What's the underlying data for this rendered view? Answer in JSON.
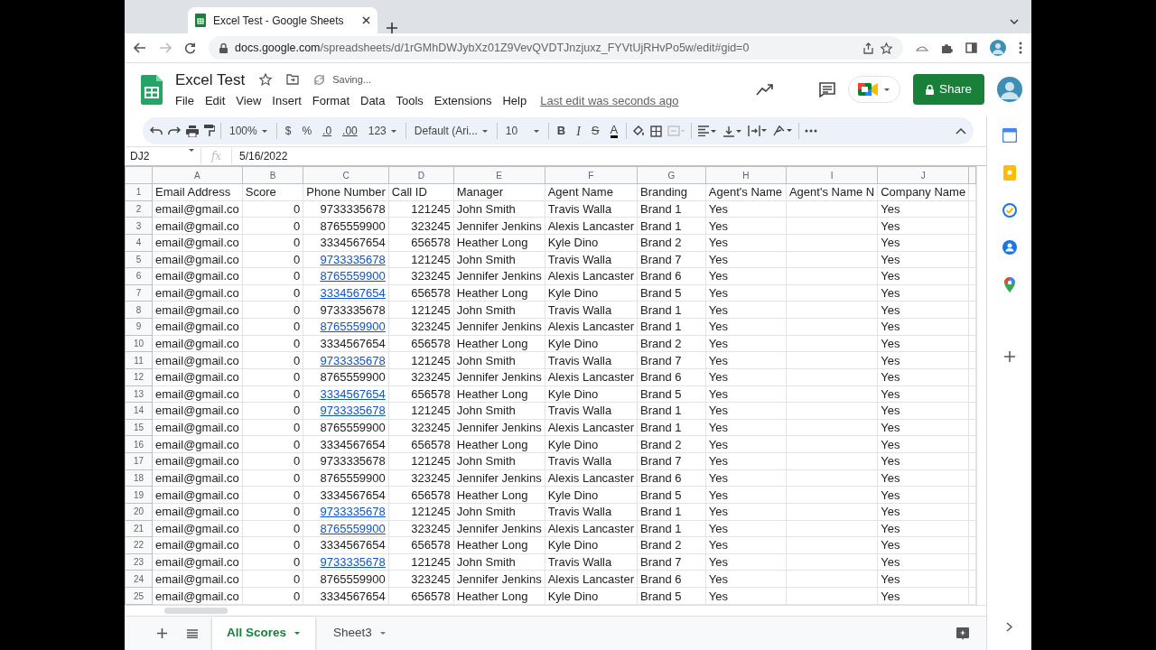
{
  "browser": {
    "tab_title": "Excel Test - Google Sheets",
    "url_host": "docs.google.com",
    "url_path": "/spreadsheets/d/1rGMhDWJybXz01Z9VevQVDTJnzjuxz_FYVtUjRHvPo5w/edit#gid=0"
  },
  "doc": {
    "title": "Excel Test",
    "save_status": "Saving...",
    "menus": [
      "File",
      "Edit",
      "View",
      "Insert",
      "Format",
      "Data",
      "Tools",
      "Extensions",
      "Help"
    ],
    "last_edit": "Last edit was seconds ago",
    "share": "Share"
  },
  "toolbar": {
    "zoom": "100%",
    "currency": "$",
    "percent": "%",
    "dec_less": ".0",
    "dec_more": ".00",
    "format": "123",
    "font": "Default (Ari...",
    "size": "10",
    "bold": "B",
    "italic": "I",
    "strike": "S",
    "text_color": "A"
  },
  "formula_bar": {
    "cell_ref": "DJ2",
    "fx": "fx",
    "value": "5/16/2022"
  },
  "header_row_num": "1",
  "columns": [
    {
      "letter": "A",
      "header": "Email Address",
      "kind": "text"
    },
    {
      "letter": "B",
      "header": "Score",
      "kind": "number"
    },
    {
      "letter": "C",
      "header": "Phone Number",
      "kind": "number"
    },
    {
      "letter": "D",
      "header": "Call ID",
      "kind": "number"
    },
    {
      "letter": "E",
      "header": "Manager",
      "kind": "text"
    },
    {
      "letter": "F",
      "header": "Agent Name",
      "kind": "text"
    },
    {
      "letter": "G",
      "header": "Branding",
      "kind": "text"
    },
    {
      "letter": "H",
      "header": "Agent's Name",
      "kind": "text"
    },
    {
      "letter": "I",
      "header": "Agent's Name N",
      "kind": "text"
    },
    {
      "letter": "J",
      "header": "Company Name",
      "kind": "text"
    }
  ],
  "rows": [
    {
      "num": "2",
      "A": "email@gmail.co",
      "B": "0",
      "C": "9733335678",
      "D": "121245",
      "E": "John Smith",
      "F": "Travis Walla",
      "G": "Brand 1",
      "H": "Yes",
      "J": "Yes",
      "phone_link": false
    },
    {
      "num": "3",
      "A": "email@gmail.co",
      "B": "0",
      "C": "8765559900",
      "D": "323245",
      "E": "Jennifer Jenkins",
      "F": "Alexis Lancaster",
      "G": "Brand 1",
      "H": "Yes",
      "J": "Yes",
      "phone_link": false
    },
    {
      "num": "4",
      "A": "email@gmail.co",
      "B": "0",
      "C": "3334567654",
      "D": "656578",
      "E": "Heather Long",
      "F": "Kyle Dino",
      "G": "Brand 2",
      "H": "Yes",
      "J": "Yes",
      "phone_link": false
    },
    {
      "num": "5",
      "A": "email@gmail.co",
      "B": "0",
      "C": "9733335678",
      "D": "121245",
      "E": "John Smith",
      "F": "Travis Walla",
      "G": "Brand 7",
      "H": "Yes",
      "J": "Yes",
      "phone_link": true
    },
    {
      "num": "6",
      "A": "email@gmail.co",
      "B": "0",
      "C": "8765559900",
      "D": "323245",
      "E": "Jennifer Jenkins",
      "F": "Alexis Lancaster",
      "G": "Brand 6",
      "H": "Yes",
      "J": "Yes",
      "phone_link": true
    },
    {
      "num": "7",
      "A": "email@gmail.co",
      "B": "0",
      "C": "3334567654",
      "D": "656578",
      "E": "Heather Long",
      "F": "Kyle Dino",
      "G": "Brand 5",
      "H": "Yes",
      "J": "Yes",
      "phone_link": true
    },
    {
      "num": "8",
      "A": "email@gmail.co",
      "B": "0",
      "C": "9733335678",
      "D": "121245",
      "E": "John Smith",
      "F": "Travis Walla",
      "G": "Brand 1",
      "H": "Yes",
      "J": "Yes",
      "phone_link": false
    },
    {
      "num": "9",
      "A": "email@gmail.co",
      "B": "0",
      "C": "8765559900",
      "D": "323245",
      "E": "Jennifer Jenkins",
      "F": "Alexis Lancaster",
      "G": "Brand 1",
      "H": "Yes",
      "J": "Yes",
      "phone_link": true
    },
    {
      "num": "10",
      "A": "email@gmail.co",
      "B": "0",
      "C": "3334567654",
      "D": "656578",
      "E": "Heather Long",
      "F": "Kyle Dino",
      "G": "Brand 2",
      "H": "Yes",
      "J": "Yes",
      "phone_link": false
    },
    {
      "num": "11",
      "A": "email@gmail.co",
      "B": "0",
      "C": "9733335678",
      "D": "121245",
      "E": "John Smith",
      "F": "Travis Walla",
      "G": "Brand 7",
      "H": "Yes",
      "J": "Yes",
      "phone_link": true
    },
    {
      "num": "12",
      "A": "email@gmail.co",
      "B": "0",
      "C": "8765559900",
      "D": "323245",
      "E": "Jennifer Jenkins",
      "F": "Alexis Lancaster",
      "G": "Brand 6",
      "H": "Yes",
      "J": "Yes",
      "phone_link": false
    },
    {
      "num": "13",
      "A": "email@gmail.co",
      "B": "0",
      "C": "3334567654",
      "D": "656578",
      "E": "Heather Long",
      "F": "Kyle Dino",
      "G": "Brand 5",
      "H": "Yes",
      "J": "Yes",
      "phone_link": true
    },
    {
      "num": "14",
      "A": "email@gmail.co",
      "B": "0",
      "C": "9733335678",
      "D": "121245",
      "E": "John Smith",
      "F": "Travis Walla",
      "G": "Brand 1",
      "H": "Yes",
      "J": "Yes",
      "phone_link": true
    },
    {
      "num": "15",
      "A": "email@gmail.co",
      "B": "0",
      "C": "8765559900",
      "D": "323245",
      "E": "Jennifer Jenkins",
      "F": "Alexis Lancaster",
      "G": "Brand 1",
      "H": "Yes",
      "J": "Yes",
      "phone_link": false
    },
    {
      "num": "16",
      "A": "email@gmail.co",
      "B": "0",
      "C": "3334567654",
      "D": "656578",
      "E": "Heather Long",
      "F": "Kyle Dino",
      "G": "Brand 2",
      "H": "Yes",
      "J": "Yes",
      "phone_link": false
    },
    {
      "num": "17",
      "A": "email@gmail.co",
      "B": "0",
      "C": "9733335678",
      "D": "121245",
      "E": "John Smith",
      "F": "Travis Walla",
      "G": "Brand 7",
      "H": "Yes",
      "J": "Yes",
      "phone_link": false
    },
    {
      "num": "18",
      "A": "email@gmail.co",
      "B": "0",
      "C": "8765559900",
      "D": "323245",
      "E": "Jennifer Jenkins",
      "F": "Alexis Lancaster",
      "G": "Brand 6",
      "H": "Yes",
      "J": "Yes",
      "phone_link": false
    },
    {
      "num": "19",
      "A": "email@gmail.co",
      "B": "0",
      "C": "3334567654",
      "D": "656578",
      "E": "Heather Long",
      "F": "Kyle Dino",
      "G": "Brand 5",
      "H": "Yes",
      "J": "Yes",
      "phone_link": false
    },
    {
      "num": "20",
      "A": "email@gmail.co",
      "B": "0",
      "C": "9733335678",
      "D": "121245",
      "E": "John Smith",
      "F": "Travis Walla",
      "G": "Brand 1",
      "H": "Yes",
      "J": "Yes",
      "phone_link": true
    },
    {
      "num": "21",
      "A": "email@gmail.co",
      "B": "0",
      "C": "8765559900",
      "D": "323245",
      "E": "Jennifer Jenkins",
      "F": "Alexis Lancaster",
      "G": "Brand 1",
      "H": "Yes",
      "J": "Yes",
      "phone_link": true
    },
    {
      "num": "22",
      "A": "email@gmail.co",
      "B": "0",
      "C": "3334567654",
      "D": "656578",
      "E": "Heather Long",
      "F": "Kyle Dino",
      "G": "Brand 2",
      "H": "Yes",
      "J": "Yes",
      "phone_link": false
    },
    {
      "num": "23",
      "A": "email@gmail.co",
      "B": "0",
      "C": "9733335678",
      "D": "121245",
      "E": "John Smith",
      "F": "Travis Walla",
      "G": "Brand 7",
      "H": "Yes",
      "J": "Yes",
      "phone_link": true
    },
    {
      "num": "24",
      "A": "email@gmail.co",
      "B": "0",
      "C": "8765559900",
      "D": "323245",
      "E": "Jennifer Jenkins",
      "F": "Alexis Lancaster",
      "G": "Brand 6",
      "H": "Yes",
      "J": "Yes",
      "phone_link": false
    },
    {
      "num": "25",
      "A": "email@gmail.co",
      "B": "0",
      "C": "3334567654",
      "D": "656578",
      "E": "Heather Long",
      "F": "Kyle Dino",
      "G": "Brand 5",
      "H": "Yes",
      "J": "Yes",
      "phone_link": false
    }
  ],
  "sheet_tabs": [
    {
      "label": "All Scores",
      "selected": true
    },
    {
      "label": "Sheet3",
      "selected": false
    }
  ]
}
